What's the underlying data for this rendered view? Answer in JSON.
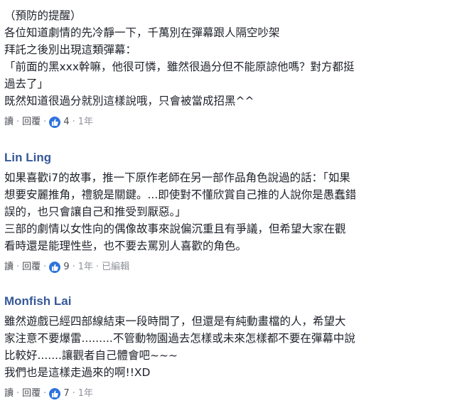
{
  "comments": [
    {
      "author": "",
      "lines": [
        "（預防的提醒）",
        "各位知道劇情的先冷靜一下，千萬別在彈幕跟人隔空吵架",
        "拜託之後別出現這類彈幕：",
        "「前面的黑xxx幹嘛，他很可憐，雖然很過分但不能原諒他嗎？對方都挺",
        "過去了」",
        "既然知道很過分就別這樣說哦，只會被當成招黑^^"
      ],
      "reply_label": "讀",
      "reply2_label": "回覆",
      "like_count": "4",
      "time": "1年",
      "edited": ""
    },
    {
      "author": "Lin Ling",
      "lines": [
        "如果喜歡i7的故事，推一下原作老師在另一部作品角色說過的話：「如果",
        "想要安麗推角，禮貌是關鍵。...即使對不懂欣賞自己推的人說你是愚蠢錯",
        "誤的，也只會讓自己和推受到厭惡。」",
        "三部的劇情以女性向的偶像故事來說偏沉重且有爭議，但希望大家在觀",
        "看時還是能理性些，也不要去罵別人喜歡的角色。"
      ],
      "reply_label": "讀",
      "reply2_label": "回覆",
      "like_count": "9",
      "time": "1年",
      "edited": "已編輯"
    },
    {
      "author": "Monfish Lai",
      "lines": [
        "雖然遊戲已經四部線結束一段時間了，但還是有純動畫檔的人，希望大",
        "家注意不要爆雷.........不管動物園過去怎樣或未來怎樣都不要在彈幕中說",
        "比較好.......讓觀者自己體會吧~~~",
        "我們也是這樣走過來的啊!!XD"
      ],
      "reply_label": "讀",
      "reply2_label": "回覆",
      "like_count": "7",
      "time": "1年",
      "edited": ""
    }
  ],
  "colors": {
    "author": "#365899",
    "text": "#1d2129",
    "meta": "#90949c",
    "like": "#2f73dd"
  },
  "icons": {
    "like": "thumbs-up-icon"
  }
}
